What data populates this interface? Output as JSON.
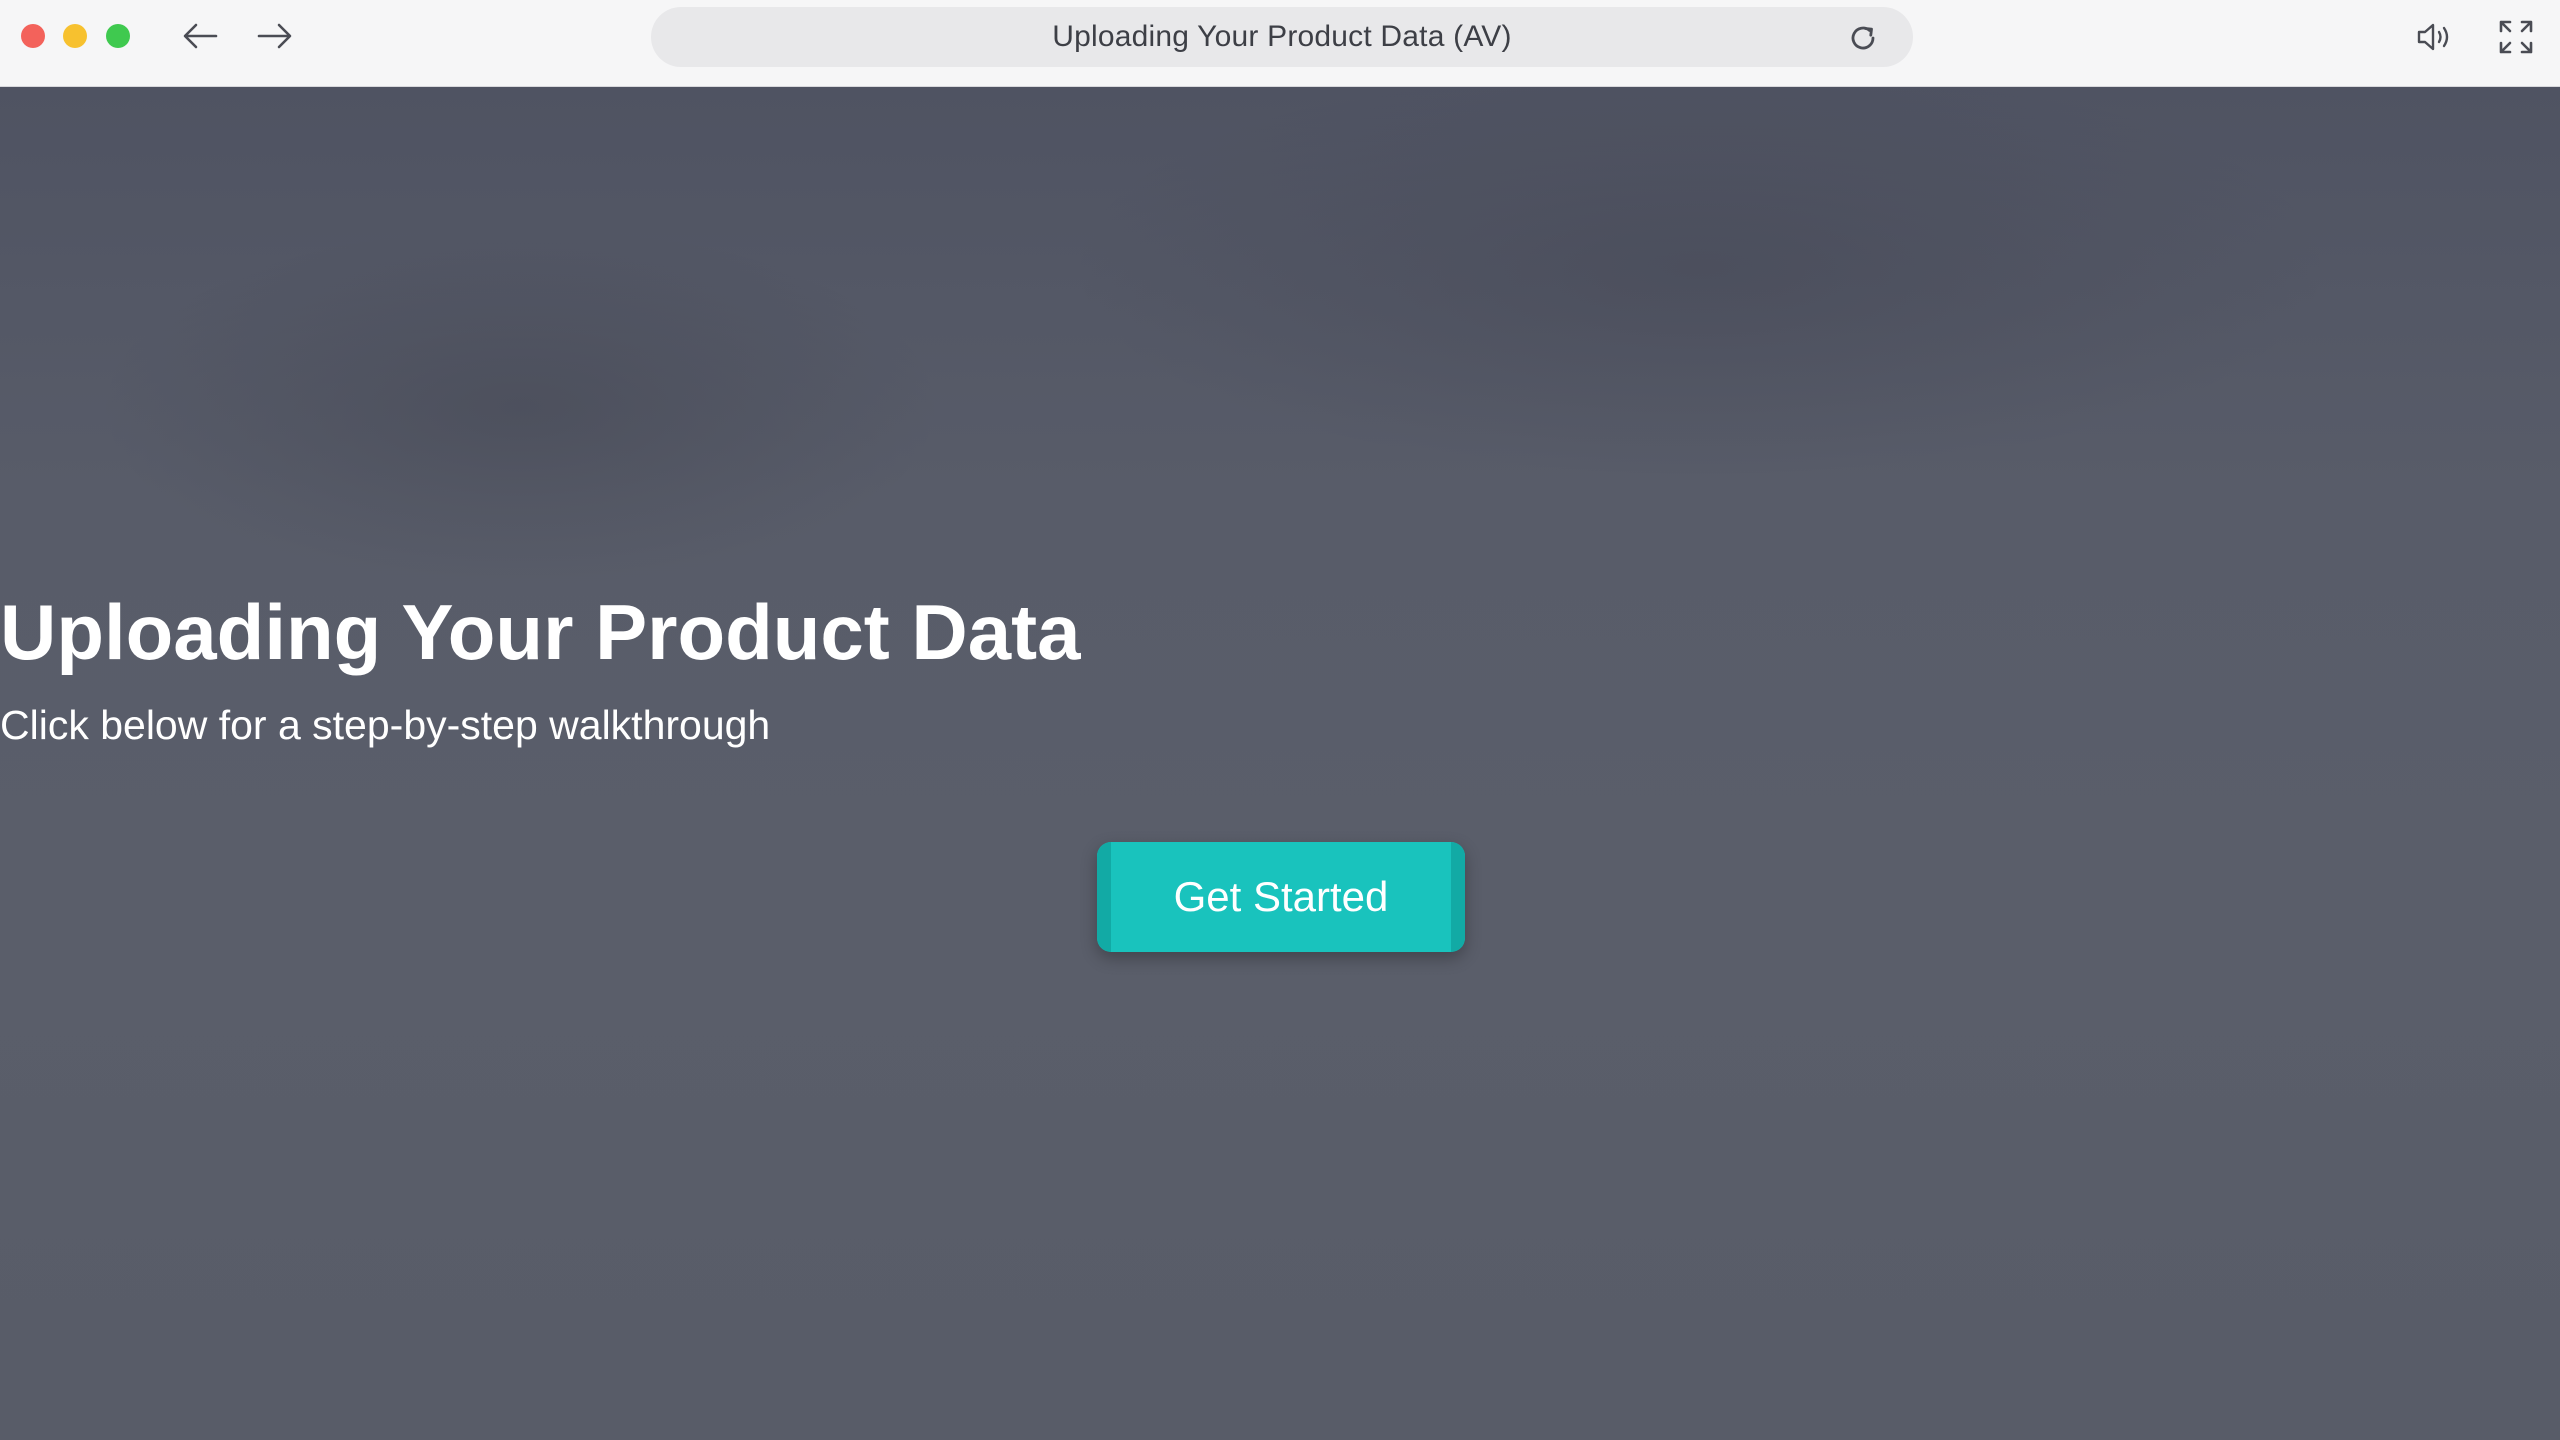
{
  "window": {
    "title": "Uploading Your Product Data (AV)"
  },
  "toolbar": {
    "traffic_lights": [
      "close",
      "minimize",
      "zoom"
    ],
    "icons": {
      "back": "arrow-left-icon",
      "forward": "arrow-right-icon",
      "reload": "reload-icon",
      "volume": "volume-icon",
      "fullscreen": "fullscreen-icon"
    }
  },
  "hero": {
    "title": "Uploading Your Product Data",
    "subtitle": "Click below for a step-by-step walkthrough",
    "cta_label": "Get Started"
  },
  "colors": {
    "accent": "#19c3bd",
    "background": "#585c68",
    "close": "#f3625b",
    "minimize": "#f7c12f",
    "zoom": "#3fc94f"
  }
}
